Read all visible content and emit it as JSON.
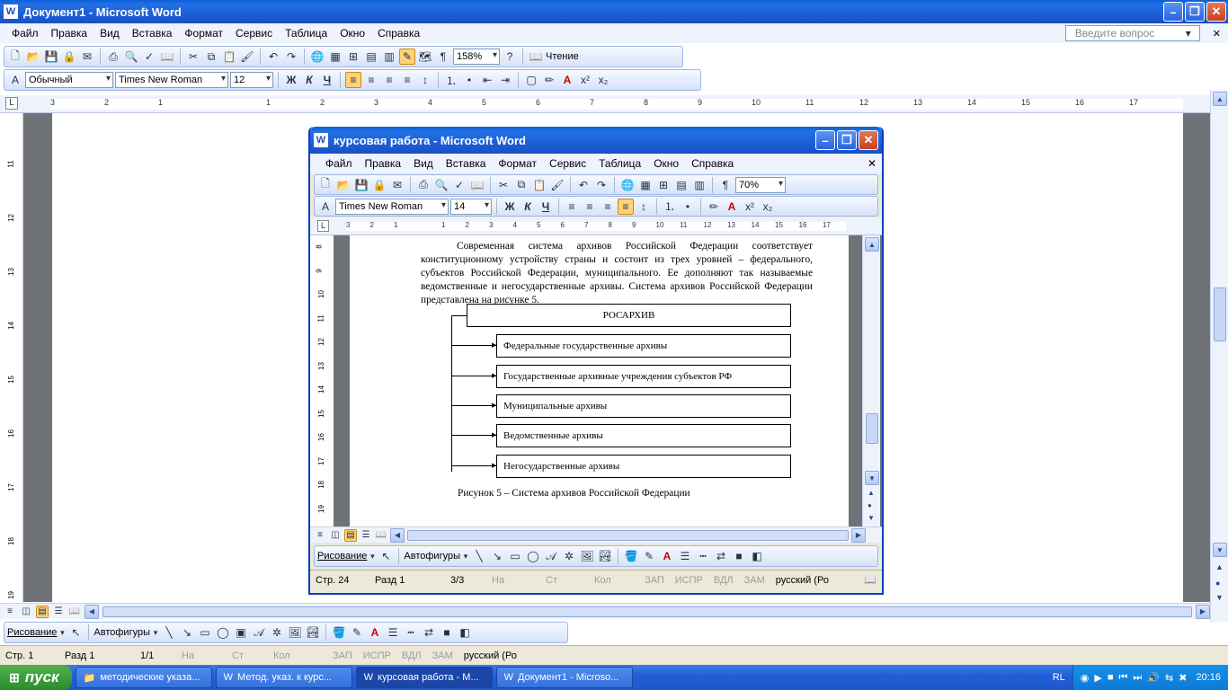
{
  "outer": {
    "title": "Документ1 - Microsoft Word",
    "menu": [
      "Файл",
      "Правка",
      "Вид",
      "Вставка",
      "Формат",
      "Сервис",
      "Таблица",
      "Окно",
      "Справка"
    ],
    "help_placeholder": "Введите вопрос",
    "zoom": "158%",
    "reading": "Чтение",
    "style": "Обычный",
    "font": "Times New Roman",
    "size": "12",
    "bold": "Ж",
    "italic": "К",
    "underline": "Ч",
    "ruler_numbers": [
      "3",
      "2",
      "1",
      "",
      "1",
      "2",
      "3",
      "4",
      "5",
      "6",
      "7",
      "8",
      "9",
      "10",
      "11",
      "12",
      "13",
      "14",
      "15",
      "16",
      "17"
    ],
    "vruler_numbers": [
      "11",
      "12",
      "13",
      "14",
      "15",
      "16",
      "17",
      "18",
      "19"
    ],
    "drawing_label": "Рисование",
    "autoshapes_label": "Автофигуры",
    "status": {
      "page": "Стр.  1",
      "section": "Разд  1",
      "pages": "1/1",
      "at": "На",
      "ln": "Ст",
      "col": "Кол",
      "rec": "ЗАП",
      "trk": "ИСПР",
      "ext": "ВДЛ",
      "ovr": "ЗАМ",
      "lang": "русский (Ро"
    }
  },
  "inner": {
    "title": "курсовая работа - Microsoft Word",
    "menu": [
      "Файл",
      "Правка",
      "Вид",
      "Вставка",
      "Формат",
      "Сервис",
      "Таблица",
      "Окно",
      "Справка"
    ],
    "zoom": "70%",
    "font": "Times New Roman",
    "size": "14",
    "bold": "Ж",
    "italic": "К",
    "underline": "Ч",
    "ruler_numbers": [
      "3",
      "2",
      "1",
      "",
      "1",
      "2",
      "3",
      "4",
      "5",
      "6",
      "7",
      "8",
      "9",
      "10",
      "11",
      "12",
      "13",
      "14",
      "15",
      "16",
      "17"
    ],
    "vruler_numbers": [
      "8",
      "9",
      "10",
      "11",
      "12",
      "13",
      "14",
      "15",
      "16",
      "17",
      "18",
      "19"
    ],
    "paragraph": "Современная система архивов Российской Федерации соответствует конституционному устройству страны и состоит из трех уровней – федерального, субъектов Российской Федерации, муниципального. Ее дополняют так называемые ведомственные и негосударственные архивы. Система архивов Российской Федерации представлена на рисунке 5.",
    "diagram": {
      "root": "РОСАРХИВ",
      "children": [
        "Федеральные государственные архивы",
        "Государственные архивные учреждения субъектов РФ",
        "Муниципальные архивы",
        "Ведомственные архивы",
        "Негосударственные архивы"
      ]
    },
    "caption": "Рисунок 5 – Система архивов Российской Федерации",
    "drawing_label": "Рисование",
    "autoshapes_label": "Автофигуры",
    "status": {
      "page": "Стр.  24",
      "section": "Разд  1",
      "pages": "3/3",
      "at": "На",
      "ln": "Ст",
      "col": "Кол",
      "rec": "ЗАП",
      "trk": "ИСПР",
      "ext": "ВДЛ",
      "ovr": "ЗАМ",
      "lang": "русский (Ро"
    }
  },
  "taskbar": {
    "start": "пуск",
    "items": [
      "методические указа...",
      "Метод. указ. к курс...",
      "курсовая работа - М...",
      "Документ1 - Microso..."
    ],
    "lang": "RL",
    "time": "20:16"
  }
}
